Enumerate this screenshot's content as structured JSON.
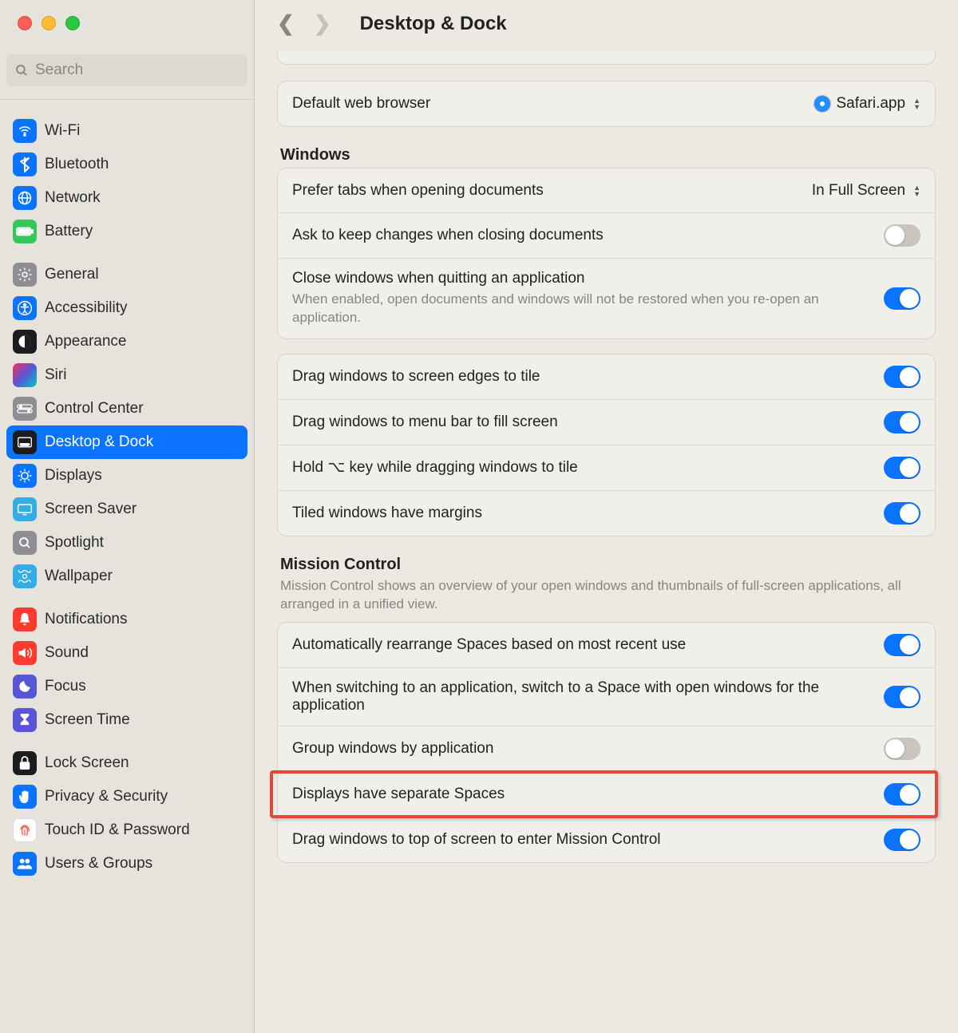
{
  "search": {
    "placeholder": "Search"
  },
  "sidebar": {
    "groups": [
      {
        "items": [
          {
            "label": "Wi-Fi"
          },
          {
            "label": "Bluetooth"
          },
          {
            "label": "Network"
          },
          {
            "label": "Battery"
          }
        ]
      },
      {
        "items": [
          {
            "label": "General"
          },
          {
            "label": "Accessibility"
          },
          {
            "label": "Appearance"
          },
          {
            "label": "Siri"
          },
          {
            "label": "Control Center"
          },
          {
            "label": "Desktop & Dock"
          },
          {
            "label": "Displays"
          },
          {
            "label": "Screen Saver"
          },
          {
            "label": "Spotlight"
          },
          {
            "label": "Wallpaper"
          }
        ]
      },
      {
        "items": [
          {
            "label": "Notifications"
          },
          {
            "label": "Sound"
          },
          {
            "label": "Focus"
          },
          {
            "label": "Screen Time"
          }
        ]
      },
      {
        "items": [
          {
            "label": "Lock Screen"
          },
          {
            "label": "Privacy & Security"
          },
          {
            "label": "Touch ID & Password"
          },
          {
            "label": "Users & Groups"
          }
        ]
      }
    ]
  },
  "header": {
    "title": "Desktop & Dock"
  },
  "browser": {
    "label": "Default web browser",
    "value": "Safari.app"
  },
  "windows": {
    "title": "Windows",
    "prefer_tabs": {
      "label": "Prefer tabs when opening documents",
      "value": "In Full Screen"
    },
    "ask_keep": {
      "label": "Ask to keep changes when closing documents"
    },
    "close_quit": {
      "label": "Close windows when quitting an application",
      "desc": "When enabled, open documents and windows will not be restored when you re-open an application."
    },
    "tile1": {
      "label": "Drag windows to screen edges to tile"
    },
    "tile2": {
      "label": "Drag windows to menu bar to fill screen"
    },
    "tile3": {
      "label": "Hold ⌥ key while dragging windows to tile"
    },
    "tile4": {
      "label": "Tiled windows have margins"
    }
  },
  "mission": {
    "title": "Mission Control",
    "desc": "Mission Control shows an overview of your open windows and thumbnails of full-screen applications, all arranged in a unified view.",
    "r1": {
      "label": "Automatically rearrange Spaces based on most recent use"
    },
    "r2": {
      "label": "When switching to an application, switch to a Space with open windows for the application"
    },
    "r3": {
      "label": "Group windows by application"
    },
    "r4": {
      "label": "Displays have separate Spaces"
    },
    "r5": {
      "label": "Drag windows to top of screen to enter Mission Control"
    }
  }
}
